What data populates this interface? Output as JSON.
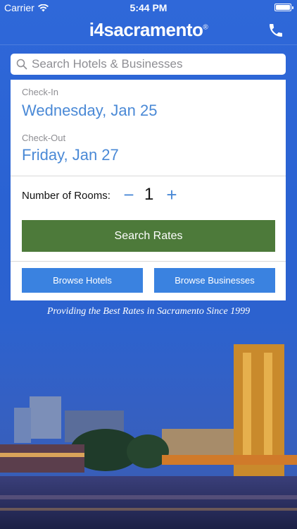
{
  "status_bar": {
    "carrier": "Carrier",
    "time": "5:44 PM",
    "wifi_icon": "wifi-icon",
    "battery_icon": "battery-icon"
  },
  "header": {
    "logo": "i4sacramento",
    "logo_mark": "®",
    "phone_icon": "phone-icon"
  },
  "search": {
    "placeholder": "Search Hotels & Businesses",
    "icon": "search-icon"
  },
  "dates": {
    "check_in_label": "Check-In",
    "check_in_value": "Wednesday, Jan 25",
    "check_out_label": "Check-Out",
    "check_out_value": "Friday, Jan 27"
  },
  "rooms": {
    "label": "Number of Rooms:",
    "minus": "−",
    "count": "1",
    "plus": "+"
  },
  "actions": {
    "search_rates": "Search Rates",
    "browse_hotels": "Browse Hotels",
    "browse_businesses": "Browse Businesses"
  },
  "tagline": "Providing the Best Rates in Sacramento Since 1999",
  "colors": {
    "background": "#2f68d9",
    "accent_blue": "#4a89d6",
    "button_blue": "#3a82e0",
    "search_green": "#4d7a3a"
  }
}
